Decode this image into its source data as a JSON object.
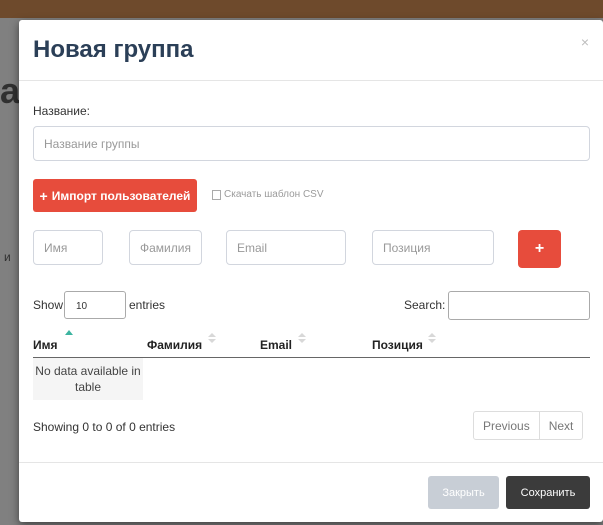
{
  "background": {
    "heading_fragment": "a",
    "side_fragment": "и"
  },
  "modal": {
    "title": "Новая группа",
    "close_glyph": "×",
    "name_label": "Название:",
    "name_placeholder": "Название группы",
    "import_button": "Импорт пользователей",
    "csv_link": "Скачать шаблон CSV",
    "new_user": {
      "first_placeholder": "Имя",
      "last_placeholder": "Фамилия",
      "email_placeholder": "Email",
      "position_placeholder": "Позиция",
      "add_glyph": "+"
    },
    "table": {
      "show_label": "Show",
      "entries_value": "10",
      "entries_label": "entries",
      "search_label": "Search:",
      "columns": [
        "Имя",
        "Фамилия",
        "Email",
        "Позиция"
      ],
      "empty_message": "No data available in table",
      "info": "Showing 0 to 0 of 0 entries",
      "prev_label": "Previous",
      "next_label": "Next"
    },
    "footer": {
      "close_label": "Закрыть",
      "save_label": "Сохранить"
    }
  },
  "colors": {
    "accent_red": "#e74c3c",
    "title_color": "#2b3f57",
    "save_bg": "#3b3b3b",
    "close_bg": "#c8ced6",
    "sort_active": "#3cb4a0"
  },
  "icons": {
    "import_icon": "plus-icon",
    "csv_icon": "file-icon",
    "add_icon": "plus-icon",
    "close_icon": "close-icon"
  }
}
